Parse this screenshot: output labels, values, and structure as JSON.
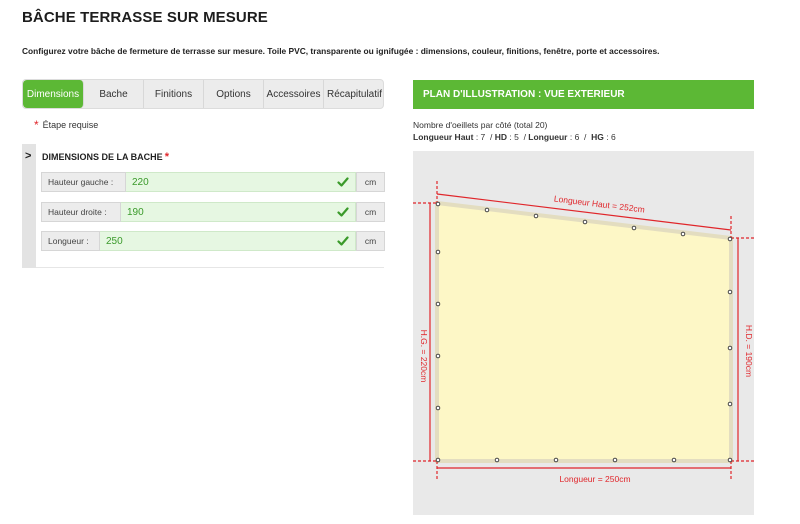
{
  "page": {
    "title": "BÂCHE TERRASSE SUR MESURE",
    "description": "Configurez votre bâche de fermeture de terrasse sur mesure. Toile PVC, transparente ou ignifugée : dimensions, couleur, finitions, fenêtre, porte et accessoires."
  },
  "tabs": [
    {
      "label": "Dimensions",
      "active": true
    },
    {
      "label": "Bache",
      "active": false
    },
    {
      "label": "Finitions",
      "active": false
    },
    {
      "label": "Options",
      "active": false
    },
    {
      "label": "Accessoires",
      "active": false
    },
    {
      "label": "Récapitulatif",
      "active": false
    }
  ],
  "required_note": {
    "star": "*",
    "text": "Étape requise"
  },
  "section": {
    "arrow": ">",
    "title": "DIMENSIONS DE LA BACHE",
    "star": "*",
    "fields": [
      {
        "label": "Hauteur gauche :",
        "value": "220",
        "unit": "cm"
      },
      {
        "label": "Hauteur droite :",
        "value": "190",
        "unit": "cm"
      },
      {
        "label": "Longueur :",
        "value": "250",
        "unit": "cm"
      }
    ]
  },
  "plan": {
    "header": "PLAN D'ILLUSTRATION : VUE EXTERIEUR",
    "eyelet_count_text": "Nombre d'oeillets par côté (total 20)",
    "dims": {
      "longueur_haut_label": "Longueur Haut",
      "longueur_haut_value": "7",
      "hd_label": "HD",
      "hd_value": "5",
      "longueur_label": "Longueur",
      "longueur_value": "6",
      "hg_label": "HG",
      "hg_value": "6"
    },
    "label_top": "Longueur Haut = 252cm",
    "label_bottom": "Longueur = 250cm",
    "label_left": "H.G. = 220cm",
    "label_right": "H.D. = 190cm",
    "colors": {
      "tarp_fill": "#fdf7c6",
      "tarp_border": "#e3ddc0",
      "dimension_line": "#e0262b",
      "accent_green": "#5cb835"
    }
  }
}
